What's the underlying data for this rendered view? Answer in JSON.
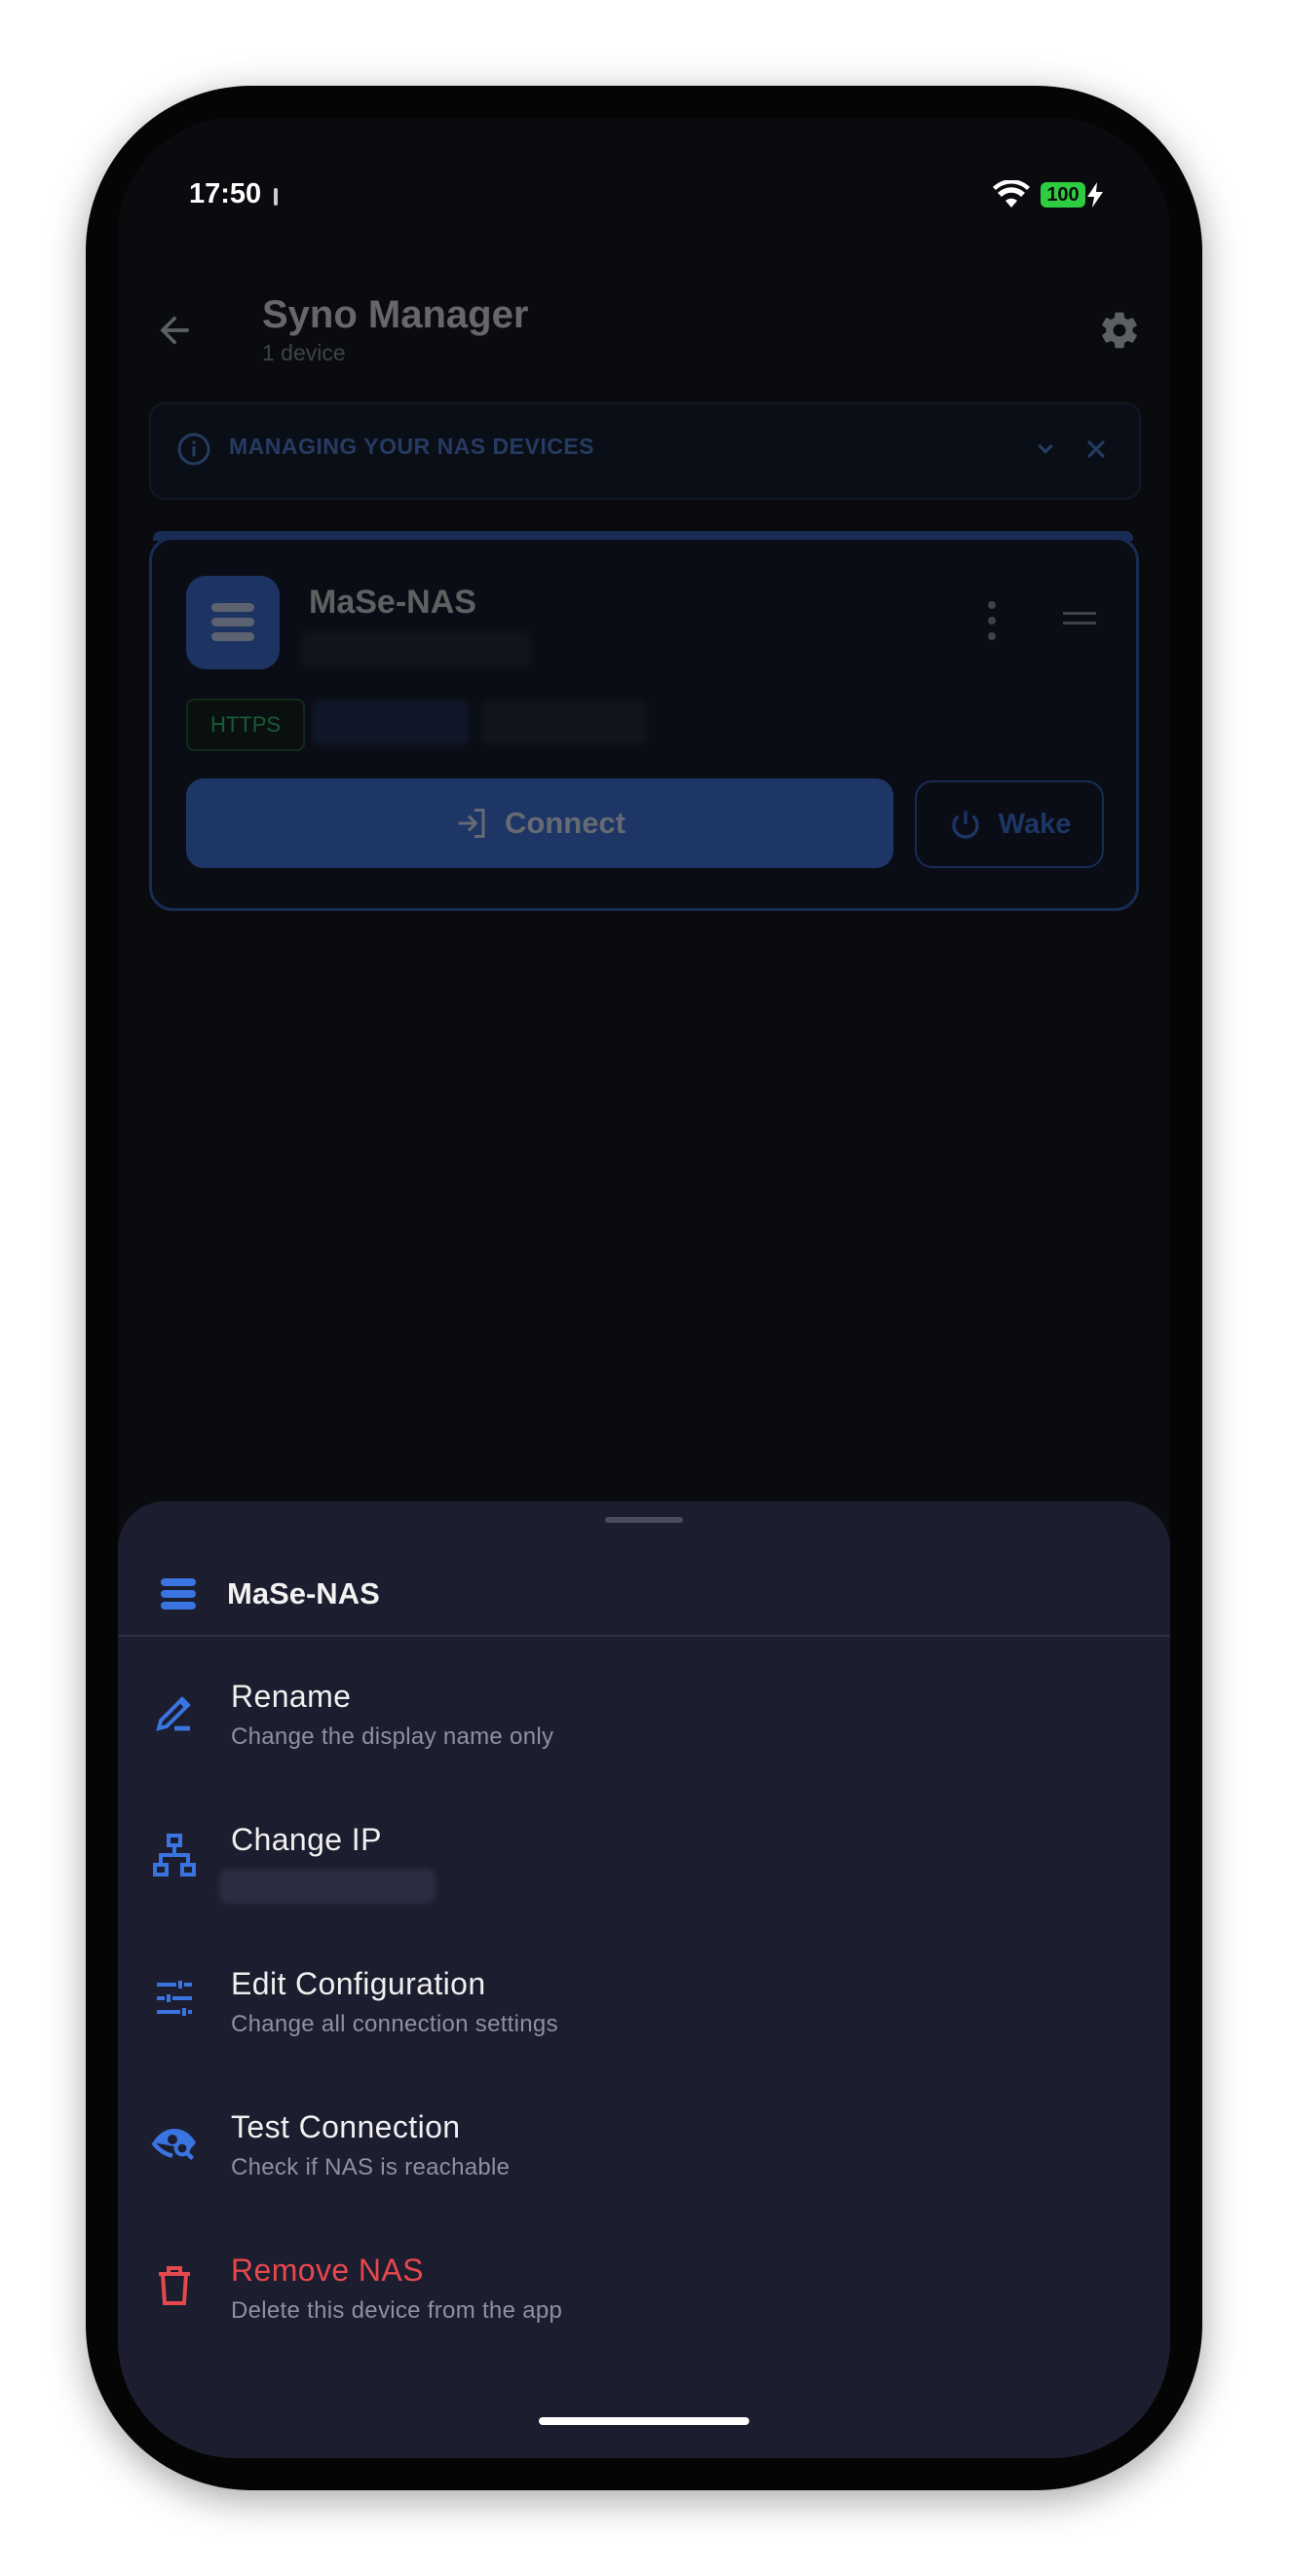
{
  "status_bar": {
    "time": "17:50",
    "battery": "100"
  },
  "app_bar": {
    "title": "Syno Manager",
    "subtitle": "1 device"
  },
  "banner": {
    "text": "MANAGING YOUR NAS DEVICES"
  },
  "device_card": {
    "name": "MaSe-NAS",
    "protocol_chip": "HTTPS",
    "connect_label": "Connect",
    "wake_label": "Wake"
  },
  "sheet": {
    "title": "MaSe-NAS",
    "items": [
      {
        "label": "Rename",
        "sub": "Change the display name only",
        "icon": "edit-icon"
      },
      {
        "label": "Change IP",
        "sub": "",
        "icon": "network-icon"
      },
      {
        "label": "Edit Configuration",
        "sub": "Change all connection settings",
        "icon": "sliders-icon"
      },
      {
        "label": "Test Connection",
        "sub": "Check if NAS is reachable",
        "icon": "eye-search-icon"
      },
      {
        "label": "Remove NAS",
        "sub": "Delete this device from the app",
        "icon": "trash-icon"
      }
    ]
  },
  "colors": {
    "accent": "#3a74e0",
    "danger": "#e5484d",
    "success": "#2ecc71",
    "sheet_bg": "#1c1d2e"
  }
}
